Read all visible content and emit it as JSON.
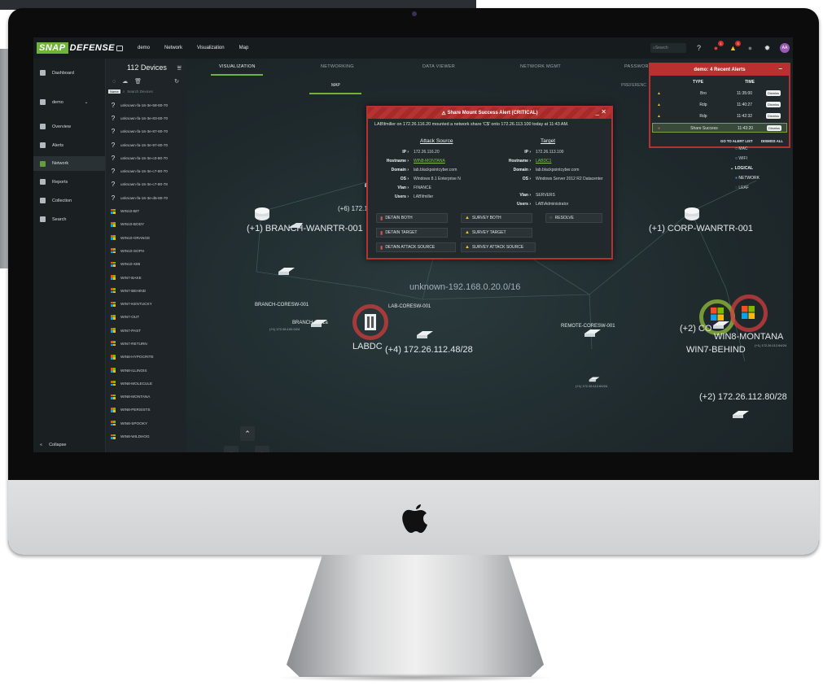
{
  "app": {
    "brand_a": "SNAP",
    "brand_b": "DEFENSE",
    "workspace": "demo",
    "nav": [
      "Network",
      "Visualization",
      "Map"
    ],
    "search_placeholder": "Search",
    "alert_badge_1": "1",
    "alert_badge_2": "3",
    "avatar_initials": "AA",
    "accent_color": "#6fb33a",
    "alert_color": "#b8302f"
  },
  "sidebar": {
    "items": [
      {
        "label": "Dashboard",
        "icon": "grid-icon"
      },
      {
        "label": "demo",
        "icon": "building-icon"
      },
      {
        "label": "Overview",
        "icon": "list-icon"
      },
      {
        "label": "Alerts",
        "icon": "alert-icon"
      },
      {
        "label": "Network",
        "icon": "network-icon"
      },
      {
        "label": "Reports",
        "icon": "chart-icon"
      },
      {
        "label": "Collection",
        "icon": "cloud-icon"
      },
      {
        "label": "Search",
        "icon": "search-icon"
      }
    ],
    "collapse_label": "Collapse"
  },
  "devices": {
    "title": "112 Devices",
    "search_filter": "Name",
    "search_placeholder": "Search Devices",
    "list": [
      "unknown-fa-16-3e-58-80-70",
      "unknown-fa-16-3e-83-80-70",
      "unknown-fa-16-3e-87-80-70",
      "unknown-fa-16-3e-97-80-70",
      "unknown-fa-16-3e-c0-80-70",
      "unknown-fa-16-3e-c7-80-70",
      "unknown-fa-16-3e-c7-80-78",
      "unknown-fa-16-3e-d6-80-70",
      "WIN10-BIT",
      "WIN10-BODY",
      "WIN10-ORANGE",
      "WIN10-SOPH",
      "WIN10-X86",
      "WIN7-BAKE",
      "WIN7-BEHIND",
      "WIN7-KENTUCKY",
      "WIN7-OUT",
      "WIN7-PAST",
      "WIN7-RETURN",
      "WIN8-HYPOCRITE",
      "WIN8-ILLINOIS",
      "WIN8-MOLECULE",
      "WIN8-MONTANA",
      "WIN8-PERSISTS",
      "WIN8-SPOOKY",
      "WIN8-WILDHOG"
    ]
  },
  "tabs": [
    "VISUALIZATION",
    "NETWORKING",
    "DATA VIEWER",
    "NETWORK MGMT",
    "PASSWORD"
  ],
  "subtab": "MAP",
  "subtab2": "PREFERENC",
  "map_labels": {
    "branch_wanrtr": "(+1) BRANCH-WANRTR-001",
    "corp_wanrtr": "(+1) CORP-WANRTR-001",
    "subnet_16": "(+6) 172.16.1.224",
    "unknown_mid": "unknown-192.168.0.20.0/16",
    "branch_coresw": "BRANCH-CORESW-001",
    "branch_idf": "BRANCH-IDF1a",
    "labdc": "LABDC",
    "lab_coresw": "LAB-CORESW-001",
    "subnet_48": "(+4) 172.26.112.48/28",
    "remote_coresw": "REMOTE-CORESW-001",
    "corp_mid": "(+2) CO",
    "win8_montana": "WIN8-MONTANA",
    "win7_behind": "WIN7-BEHIND",
    "subnet_80": "(+2) 172.26.112.80/28",
    "tiny_1": "(+1) 172.26.100.0/24",
    "tiny_2": "(+1) 172.26.112.60/24",
    "tiny_3": "(+1) 172.26.112.64/24"
  },
  "alert_popup": {
    "title": "Share Mount Success Alert (CRITICAL)",
    "message": "LAB\\fmiller on 172.26.116.20 mounted a network share 'C$' onto 172.26.113.100 today at 11:43 AM.",
    "source_title": "Attack Source",
    "target_title": "Target",
    "source": {
      "IP": "172.26.116.20",
      "Hostname": "WIN8-MONTANA",
      "Domain": "lab.blackpointcyber.com",
      "OS": "Windows 8.1 Enterprise N",
      "Vlan": "FINANCE",
      "Users": "LAB\\fmiller"
    },
    "target": {
      "IP": "172.26.113.100",
      "Hostname": "LABDC1",
      "Domain": "lab.blackpointcyber.com",
      "OS": "Windows Server 2012 R2 Datacenter",
      "Vlan": "SERVERS",
      "Users": "LAB\\Administrator"
    },
    "buttons": {
      "detain_both": "DETAIN BOTH",
      "survey_both": "SURVEY BOTH",
      "resolve": "RESOLVE",
      "detain_target": "DETAIN TARGET",
      "survey_target": "SURVEY TARGET",
      "detain_source": "DETAIN ATTACK SOURCE",
      "survey_source": "SURVEY ATTACK SOURCE"
    }
  },
  "recent_alerts": {
    "title": "demo: 4 Recent Alerts",
    "col_type": "TYPE",
    "col_time": "TIME",
    "rows": [
      {
        "type": "Bro",
        "time": "11:35:00",
        "action": "Dismiss"
      },
      {
        "type": "Rdp",
        "time": "11:40:27",
        "action": "Dismiss"
      },
      {
        "type": "Rdp",
        "time": "11:42:32",
        "action": "Dismiss"
      },
      {
        "type": "Share Success",
        "time": "11:43:20",
        "action": "Dismiss"
      }
    ],
    "go_to_list": "GO TO ALERT LIST",
    "dismiss_all": "DISMISS ALL"
  },
  "legend": {
    "mac": "MAC",
    "wifi": "WIFI",
    "logical": "LOGICAL",
    "network": "NETWORK",
    "leaf": "LEAF"
  }
}
